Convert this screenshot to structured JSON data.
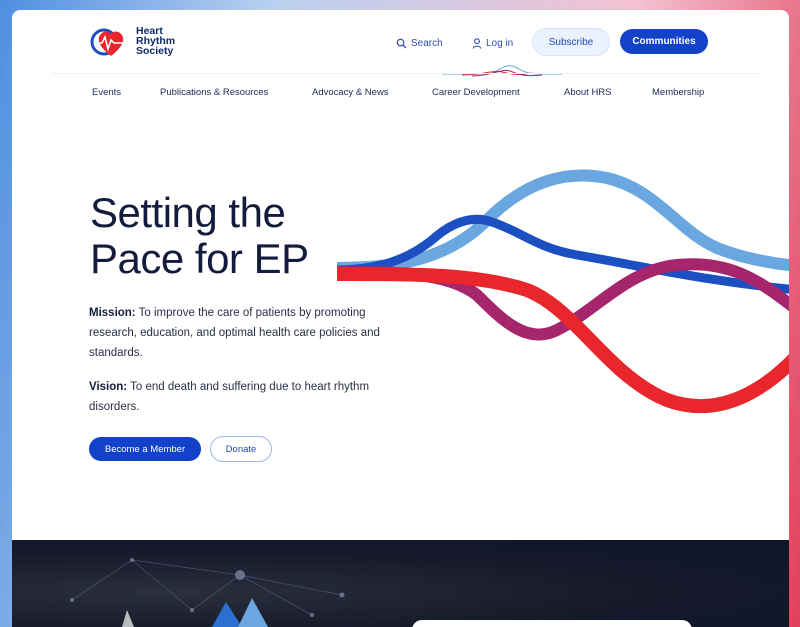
{
  "logo": {
    "line1": "Heart",
    "line2": "Rhythm",
    "line3": "Society"
  },
  "header": {
    "search_label": "Search",
    "login_label": "Log in",
    "subscribe_label": "Subscribe",
    "communities_label": "Communities"
  },
  "nav": {
    "items": [
      {
        "label": "Events"
      },
      {
        "label": "Publications & Resources"
      },
      {
        "label": "Advocacy & News"
      },
      {
        "label": "Career Development"
      },
      {
        "label": "About HRS"
      },
      {
        "label": "Membership"
      }
    ]
  },
  "hero": {
    "title_line1": "Setting the",
    "title_line2": "Pace for EP",
    "mission_label": "Mission:",
    "mission_text": " To improve the care of patients by promoting research, education, and optimal health care policies and standards.",
    "vision_label": "Vision:",
    "vision_text": " To end death and suffering due to heart rhythm disorders.",
    "member_button": "Become a Member",
    "donate_button": "Donate"
  },
  "colors": {
    "primary": "#1142c8",
    "navy": "#141c3e",
    "red": "#e8262c",
    "magenta": "#a6266e",
    "light_blue": "#6aa6e0"
  },
  "icons": [
    "search-icon",
    "user-icon",
    "heart-logo-icon"
  ]
}
